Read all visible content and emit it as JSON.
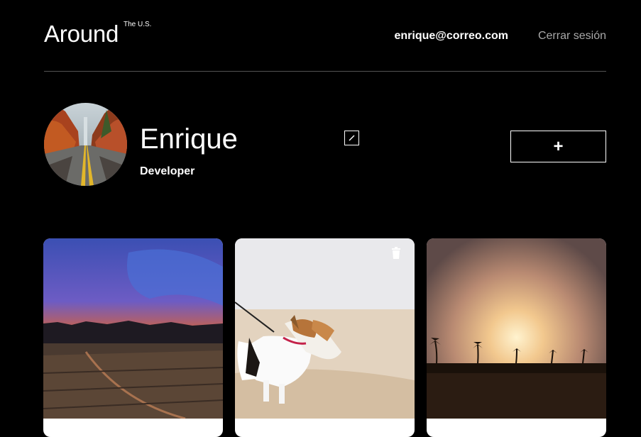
{
  "header": {
    "logo": "Around",
    "logo_superscript": "The U.S.",
    "email": "enrique@correo.com",
    "logout": "Cerrar sesión"
  },
  "profile": {
    "name": "Enrique",
    "about": "Developer",
    "edit_icon": "pencil-icon",
    "add_label": "+"
  },
  "cards": [
    {
      "image": "sunset-field",
      "trash_visible": false
    },
    {
      "image": "dog-on-beach",
      "trash_visible": true
    },
    {
      "image": "palm-sunset",
      "trash_visible": false
    }
  ],
  "icons": {
    "trash": "trash-icon"
  },
  "colors": {
    "background": "#000000",
    "text": "#ffffff",
    "muted": "#a9a9a9",
    "divider": "#545454"
  }
}
